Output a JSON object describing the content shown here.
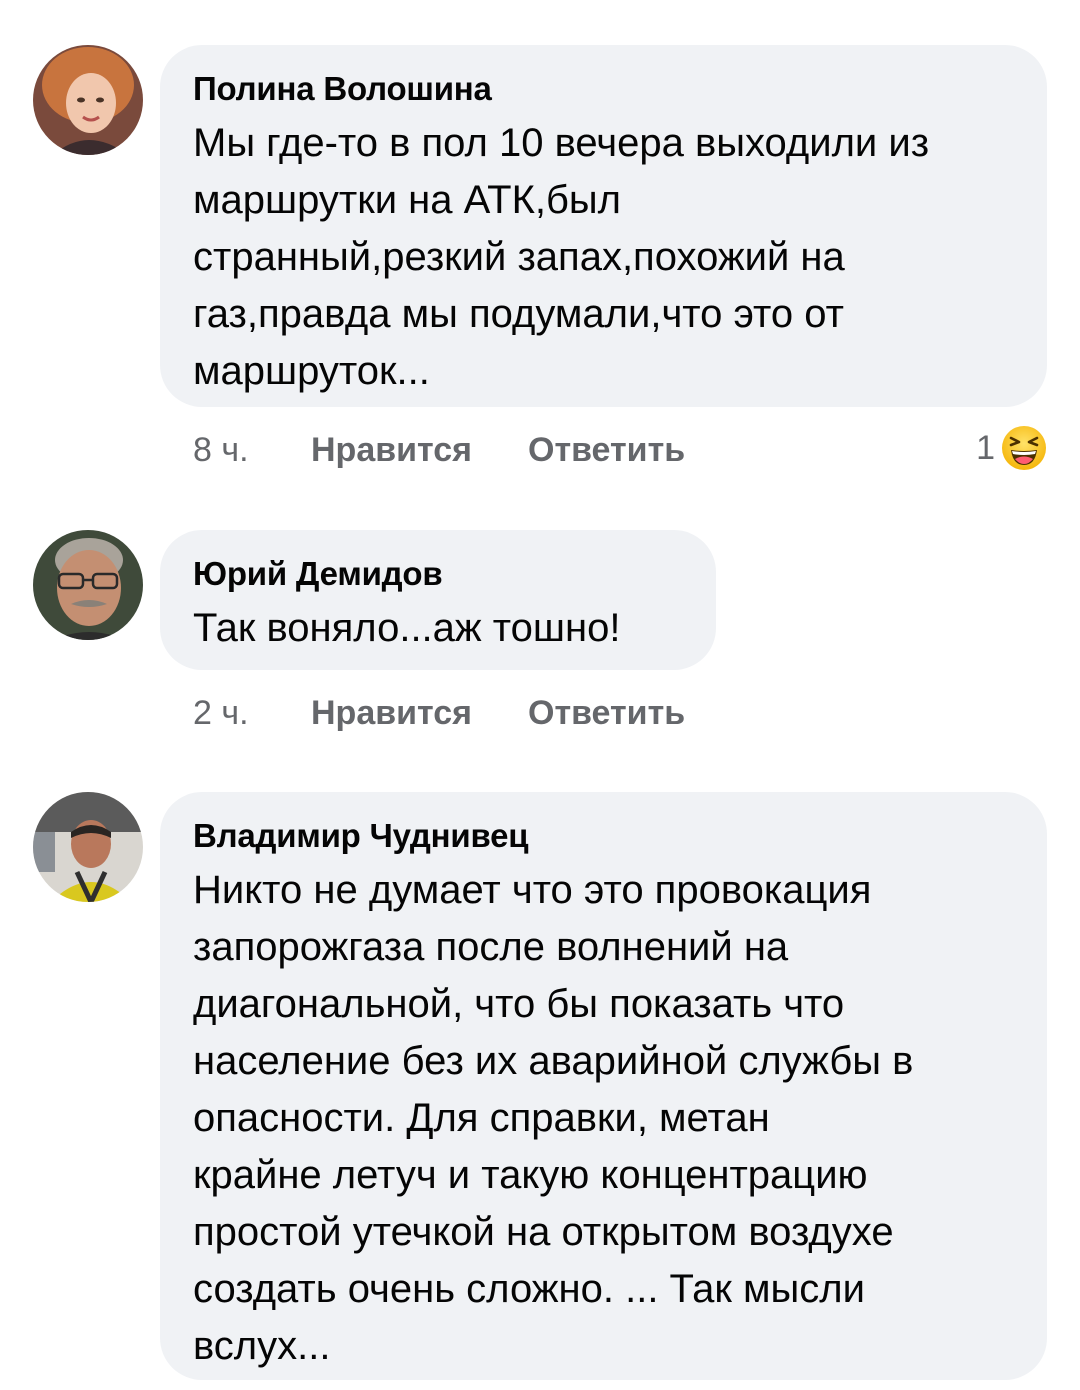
{
  "comments": [
    {
      "author": "Полина Волошина",
      "text": "Мы где-то в пол 10 вечера выходили из\nмаршрутки на АТК,был\nстранный,резкий запах,похожий на\nгаз,правда мы подумали,что это от\nмаршруток...",
      "time": "8 ч.",
      "like_label": "Нравится",
      "reply_label": "Ответить",
      "reaction_count": "1",
      "reaction_icon": "laughing-emoji-icon"
    },
    {
      "author": "Юрий Демидов",
      "text": "Так воняло...аж тошно!",
      "time": "2 ч.",
      "like_label": "Нравится",
      "reply_label": "Ответить"
    },
    {
      "author": "Владимир Чуднивец",
      "text": "Никто не думает что это провокация\nзапорожгаза после волнений на\nдиагональной,  что бы показать что\nнаселение без их аварийной службы в\nопасности.  Для справки,  метан\nкрайне летуч и такую концентрацию\nпростой утечкой на открытом воздухе\nсоздать очень сложно. ... Так мысли\nвслух..."
    }
  ],
  "colors": {
    "bubble_bg": "#f0f2f5",
    "text": "#050505",
    "meta": "#65676b"
  }
}
